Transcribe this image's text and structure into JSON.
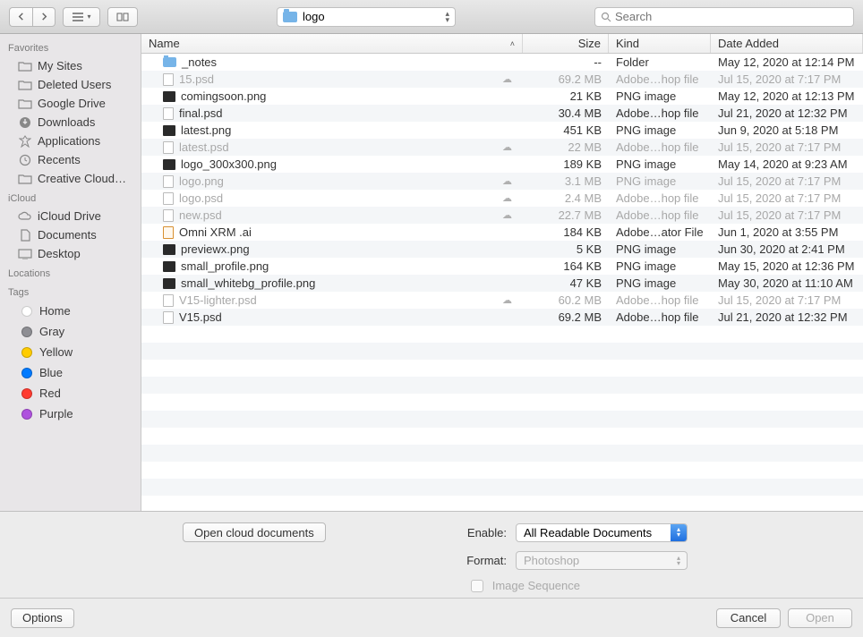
{
  "toolbar": {
    "path_label": "logo",
    "search_placeholder": "Search"
  },
  "sidebar": {
    "sections": [
      {
        "header": "Favorites",
        "items": [
          {
            "label": "My Sites",
            "icon": "folder"
          },
          {
            "label": "Deleted Users",
            "icon": "folder"
          },
          {
            "label": "Google Drive",
            "icon": "folder"
          },
          {
            "label": "Downloads",
            "icon": "download"
          },
          {
            "label": "Applications",
            "icon": "apps"
          },
          {
            "label": "Recents",
            "icon": "clock"
          },
          {
            "label": "Creative Cloud…",
            "icon": "folder"
          }
        ]
      },
      {
        "header": "iCloud",
        "items": [
          {
            "label": "iCloud Drive",
            "icon": "cloud"
          },
          {
            "label": "Documents",
            "icon": "doc"
          },
          {
            "label": "Desktop",
            "icon": "desktop"
          }
        ]
      },
      {
        "header": "Locations",
        "items": []
      },
      {
        "header": "Tags",
        "tags": [
          {
            "label": "Home",
            "color": "#ffffff"
          },
          {
            "label": "Gray",
            "color": "#8e8e93"
          },
          {
            "label": "Yellow",
            "color": "#ffcc00"
          },
          {
            "label": "Blue",
            "color": "#007aff"
          },
          {
            "label": "Red",
            "color": "#ff3b30"
          },
          {
            "label": "Purple",
            "color": "#af52de"
          }
        ]
      }
    ]
  },
  "columns": {
    "name": "Name",
    "size": "Size",
    "kind": "Kind",
    "date": "Date Added"
  },
  "files": [
    {
      "name": "_notes",
      "size": "--",
      "kind": "Folder",
      "date": "May 12, 2020 at 12:14 PM",
      "icon": "folder",
      "dim": false,
      "cloud": false
    },
    {
      "name": "15.psd",
      "size": "69.2 MB",
      "kind": "Adobe…hop file",
      "date": "Jul 15, 2020 at 7:17 PM",
      "icon": "psd",
      "dim": true,
      "cloud": true
    },
    {
      "name": "comingsoon.png",
      "size": "21 KB",
      "kind": "PNG image",
      "date": "May 12, 2020 at 12:13 PM",
      "icon": "dark",
      "dim": false,
      "cloud": false
    },
    {
      "name": "final.psd",
      "size": "30.4 MB",
      "kind": "Adobe…hop file",
      "date": "Jul 21, 2020 at 12:32 PM",
      "icon": "psd",
      "dim": false,
      "cloud": false
    },
    {
      "name": "latest.png",
      "size": "451 KB",
      "kind": "PNG image",
      "date": "Jun 9, 2020 at 5:18 PM",
      "icon": "dark",
      "dim": false,
      "cloud": false
    },
    {
      "name": "latest.psd",
      "size": "22 MB",
      "kind": "Adobe…hop file",
      "date": "Jul 15, 2020 at 7:17 PM",
      "icon": "psd",
      "dim": true,
      "cloud": true
    },
    {
      "name": "logo_300x300.png",
      "size": "189 KB",
      "kind": "PNG image",
      "date": "May 14, 2020 at 9:23 AM",
      "icon": "dark",
      "dim": false,
      "cloud": false
    },
    {
      "name": "logo.png",
      "size": "3.1 MB",
      "kind": "PNG image",
      "date": "Jul 15, 2020 at 7:17 PM",
      "icon": "doc",
      "dim": true,
      "cloud": true
    },
    {
      "name": "logo.psd",
      "size": "2.4 MB",
      "kind": "Adobe…hop file",
      "date": "Jul 15, 2020 at 7:17 PM",
      "icon": "psd",
      "dim": true,
      "cloud": true
    },
    {
      "name": "new.psd",
      "size": "22.7 MB",
      "kind": "Adobe…hop file",
      "date": "Jul 15, 2020 at 7:17 PM",
      "icon": "psd",
      "dim": true,
      "cloud": true
    },
    {
      "name": "Omni XRM .ai",
      "size": "184 KB",
      "kind": "Adobe…ator File",
      "date": "Jun 1, 2020 at 3:55 PM",
      "icon": "ai",
      "dim": false,
      "cloud": false
    },
    {
      "name": "previewx.png",
      "size": "5 KB",
      "kind": "PNG image",
      "date": "Jun 30, 2020 at 2:41 PM",
      "icon": "dark",
      "dim": false,
      "cloud": false
    },
    {
      "name": "small_profile.png",
      "size": "164 KB",
      "kind": "PNG image",
      "date": "May 15, 2020 at 12:36 PM",
      "icon": "dark",
      "dim": false,
      "cloud": false
    },
    {
      "name": "small_whitebg_profile.png",
      "size": "47 KB",
      "kind": "PNG image",
      "date": "May 30, 2020 at 11:10 AM",
      "icon": "dark",
      "dim": false,
      "cloud": false
    },
    {
      "name": "V15-lighter.psd",
      "size": "60.2 MB",
      "kind": "Adobe…hop file",
      "date": "Jul 15, 2020 at 7:17 PM",
      "icon": "psd",
      "dim": true,
      "cloud": true
    },
    {
      "name": "V15.psd",
      "size": "69.2 MB",
      "kind": "Adobe…hop file",
      "date": "Jul 21, 2020 at 12:32 PM",
      "icon": "psd",
      "dim": false,
      "cloud": false
    }
  ],
  "bottom": {
    "open_cloud": "Open cloud documents",
    "enable_label": "Enable:",
    "enable_value": "All Readable Documents",
    "format_label": "Format:",
    "format_value": "Photoshop",
    "image_sequence": "Image Sequence"
  },
  "footer": {
    "options": "Options",
    "cancel": "Cancel",
    "open": "Open"
  }
}
